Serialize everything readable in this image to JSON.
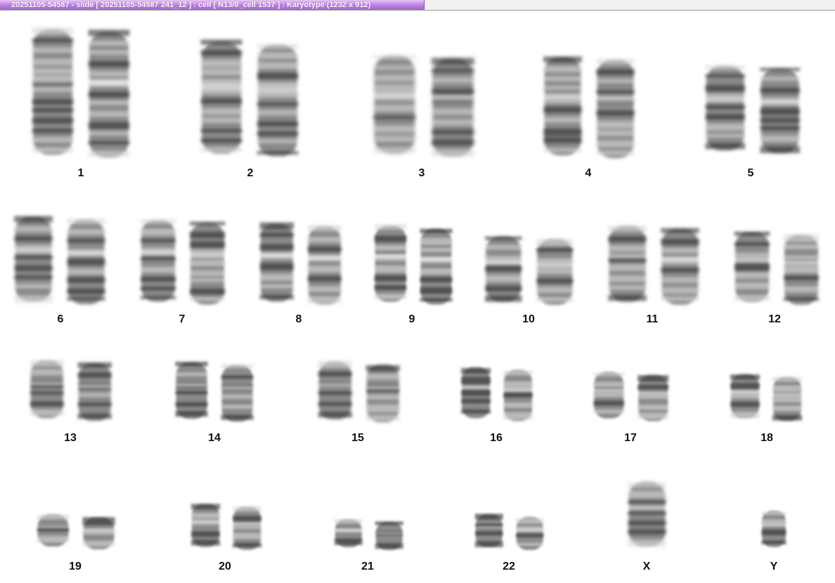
{
  "window": {
    "title": "20251105-54587 - slide [ 20251105-54587 241_12 ] : cell [ N13/0_cell 1537 ] : Karyotype  (1232 x 912)"
  },
  "karyotype": {
    "labels": [
      "1",
      "2",
      "3",
      "4",
      "5",
      "6",
      "7",
      "8",
      "9",
      "10",
      "11",
      "12",
      "13",
      "14",
      "15",
      "16",
      "17",
      "18",
      "19",
      "20",
      "21",
      "22",
      "X",
      "Y"
    ]
  }
}
